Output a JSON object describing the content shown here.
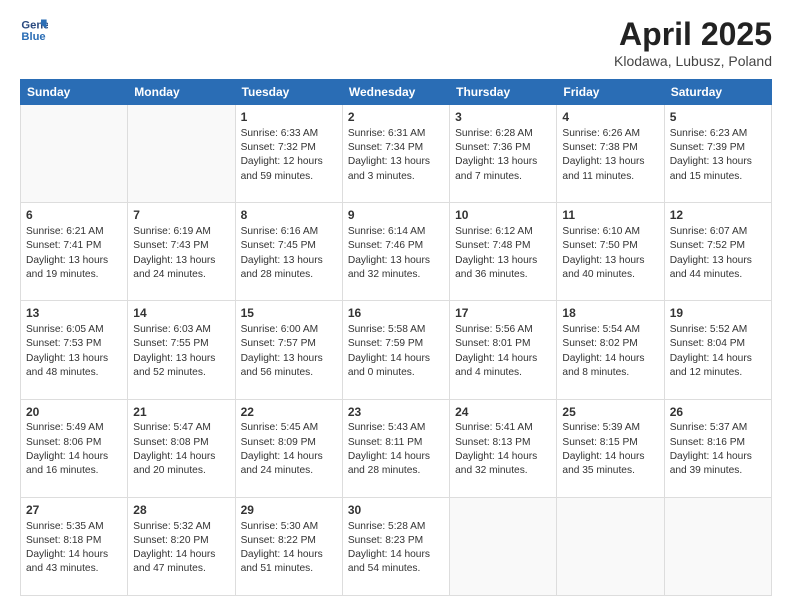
{
  "header": {
    "logo_line1": "General",
    "logo_line2": "Blue",
    "title": "April 2025",
    "subtitle": "Klodawa, Lubusz, Poland"
  },
  "weekdays": [
    "Sunday",
    "Monday",
    "Tuesday",
    "Wednesday",
    "Thursday",
    "Friday",
    "Saturday"
  ],
  "days": [
    {
      "num": "",
      "info": ""
    },
    {
      "num": "",
      "info": ""
    },
    {
      "num": "1",
      "sunrise": "Sunrise: 6:33 AM",
      "sunset": "Sunset: 7:32 PM",
      "daylight": "Daylight: 12 hours and 59 minutes."
    },
    {
      "num": "2",
      "sunrise": "Sunrise: 6:31 AM",
      "sunset": "Sunset: 7:34 PM",
      "daylight": "Daylight: 13 hours and 3 minutes."
    },
    {
      "num": "3",
      "sunrise": "Sunrise: 6:28 AM",
      "sunset": "Sunset: 7:36 PM",
      "daylight": "Daylight: 13 hours and 7 minutes."
    },
    {
      "num": "4",
      "sunrise": "Sunrise: 6:26 AM",
      "sunset": "Sunset: 7:38 PM",
      "daylight": "Daylight: 13 hours and 11 minutes."
    },
    {
      "num": "5",
      "sunrise": "Sunrise: 6:23 AM",
      "sunset": "Sunset: 7:39 PM",
      "daylight": "Daylight: 13 hours and 15 minutes."
    },
    {
      "num": "6",
      "sunrise": "Sunrise: 6:21 AM",
      "sunset": "Sunset: 7:41 PM",
      "daylight": "Daylight: 13 hours and 19 minutes."
    },
    {
      "num": "7",
      "sunrise": "Sunrise: 6:19 AM",
      "sunset": "Sunset: 7:43 PM",
      "daylight": "Daylight: 13 hours and 24 minutes."
    },
    {
      "num": "8",
      "sunrise": "Sunrise: 6:16 AM",
      "sunset": "Sunset: 7:45 PM",
      "daylight": "Daylight: 13 hours and 28 minutes."
    },
    {
      "num": "9",
      "sunrise": "Sunrise: 6:14 AM",
      "sunset": "Sunset: 7:46 PM",
      "daylight": "Daylight: 13 hours and 32 minutes."
    },
    {
      "num": "10",
      "sunrise": "Sunrise: 6:12 AM",
      "sunset": "Sunset: 7:48 PM",
      "daylight": "Daylight: 13 hours and 36 minutes."
    },
    {
      "num": "11",
      "sunrise": "Sunrise: 6:10 AM",
      "sunset": "Sunset: 7:50 PM",
      "daylight": "Daylight: 13 hours and 40 minutes."
    },
    {
      "num": "12",
      "sunrise": "Sunrise: 6:07 AM",
      "sunset": "Sunset: 7:52 PM",
      "daylight": "Daylight: 13 hours and 44 minutes."
    },
    {
      "num": "13",
      "sunrise": "Sunrise: 6:05 AM",
      "sunset": "Sunset: 7:53 PM",
      "daylight": "Daylight: 13 hours and 48 minutes."
    },
    {
      "num": "14",
      "sunrise": "Sunrise: 6:03 AM",
      "sunset": "Sunset: 7:55 PM",
      "daylight": "Daylight: 13 hours and 52 minutes."
    },
    {
      "num": "15",
      "sunrise": "Sunrise: 6:00 AM",
      "sunset": "Sunset: 7:57 PM",
      "daylight": "Daylight: 13 hours and 56 minutes."
    },
    {
      "num": "16",
      "sunrise": "Sunrise: 5:58 AM",
      "sunset": "Sunset: 7:59 PM",
      "daylight": "Daylight: 14 hours and 0 minutes."
    },
    {
      "num": "17",
      "sunrise": "Sunrise: 5:56 AM",
      "sunset": "Sunset: 8:01 PM",
      "daylight": "Daylight: 14 hours and 4 minutes."
    },
    {
      "num": "18",
      "sunrise": "Sunrise: 5:54 AM",
      "sunset": "Sunset: 8:02 PM",
      "daylight": "Daylight: 14 hours and 8 minutes."
    },
    {
      "num": "19",
      "sunrise": "Sunrise: 5:52 AM",
      "sunset": "Sunset: 8:04 PM",
      "daylight": "Daylight: 14 hours and 12 minutes."
    },
    {
      "num": "20",
      "sunrise": "Sunrise: 5:49 AM",
      "sunset": "Sunset: 8:06 PM",
      "daylight": "Daylight: 14 hours and 16 minutes."
    },
    {
      "num": "21",
      "sunrise": "Sunrise: 5:47 AM",
      "sunset": "Sunset: 8:08 PM",
      "daylight": "Daylight: 14 hours and 20 minutes."
    },
    {
      "num": "22",
      "sunrise": "Sunrise: 5:45 AM",
      "sunset": "Sunset: 8:09 PM",
      "daylight": "Daylight: 14 hours and 24 minutes."
    },
    {
      "num": "23",
      "sunrise": "Sunrise: 5:43 AM",
      "sunset": "Sunset: 8:11 PM",
      "daylight": "Daylight: 14 hours and 28 minutes."
    },
    {
      "num": "24",
      "sunrise": "Sunrise: 5:41 AM",
      "sunset": "Sunset: 8:13 PM",
      "daylight": "Daylight: 14 hours and 32 minutes."
    },
    {
      "num": "25",
      "sunrise": "Sunrise: 5:39 AM",
      "sunset": "Sunset: 8:15 PM",
      "daylight": "Daylight: 14 hours and 35 minutes."
    },
    {
      "num": "26",
      "sunrise": "Sunrise: 5:37 AM",
      "sunset": "Sunset: 8:16 PM",
      "daylight": "Daylight: 14 hours and 39 minutes."
    },
    {
      "num": "27",
      "sunrise": "Sunrise: 5:35 AM",
      "sunset": "Sunset: 8:18 PM",
      "daylight": "Daylight: 14 hours and 43 minutes."
    },
    {
      "num": "28",
      "sunrise": "Sunrise: 5:32 AM",
      "sunset": "Sunset: 8:20 PM",
      "daylight": "Daylight: 14 hours and 47 minutes."
    },
    {
      "num": "29",
      "sunrise": "Sunrise: 5:30 AM",
      "sunset": "Sunset: 8:22 PM",
      "daylight": "Daylight: 14 hours and 51 minutes."
    },
    {
      "num": "30",
      "sunrise": "Sunrise: 5:28 AM",
      "sunset": "Sunset: 8:23 PM",
      "daylight": "Daylight: 14 hours and 54 minutes."
    },
    {
      "num": "",
      "info": ""
    },
    {
      "num": "",
      "info": ""
    },
    {
      "num": "",
      "info": ""
    }
  ]
}
